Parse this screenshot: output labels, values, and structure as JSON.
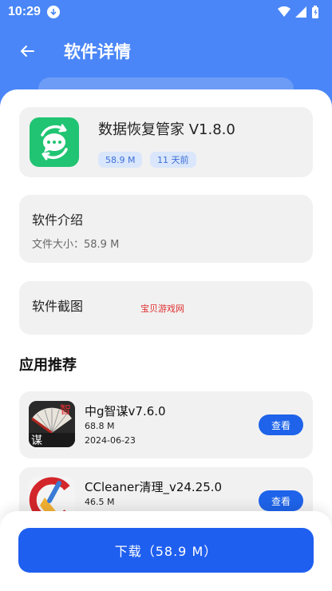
{
  "status": {
    "time": "10:29"
  },
  "nav": {
    "title": "软件详情"
  },
  "app": {
    "name": "数据恢复管家 V1.8.0",
    "size_tag": "58.9 M",
    "time_tag": "11 天前"
  },
  "intro": {
    "title": "软件介绍",
    "file_size": "文件大小：58.9 M"
  },
  "screenshots": {
    "title": "软件截图",
    "watermark": "宝贝游戏网"
  },
  "recommend": {
    "title": "应用推荐",
    "items": [
      {
        "name": "中g智谋v7.6.0",
        "size": "68.8 M",
        "date": "2024-06-23",
        "button": "查看",
        "icon_text_top": "智",
        "icon_text_bottom": "谋"
      },
      {
        "name": "CCleaner清理_v24.25.0",
        "size": "46.5 M",
        "date": "",
        "button": "查看"
      }
    ]
  },
  "download": {
    "label": "下载（58.9 M）"
  },
  "colors": {
    "header": "#4a86f7",
    "accent": "#1f5ff0",
    "app_icon": "#20c472"
  }
}
